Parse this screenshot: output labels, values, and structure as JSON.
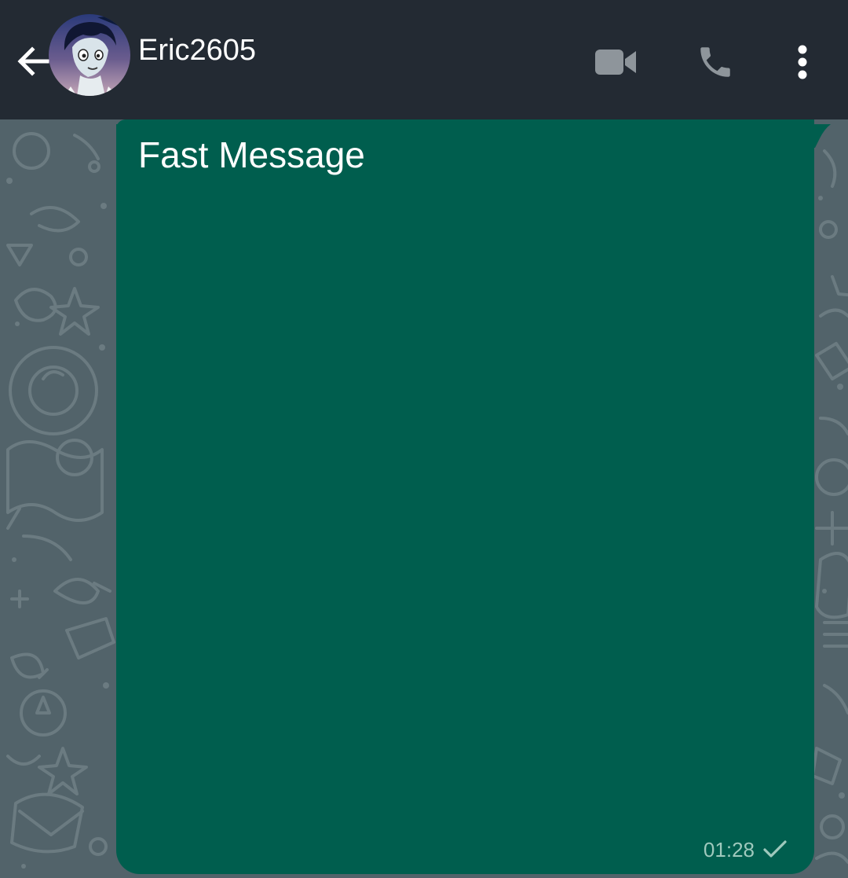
{
  "header": {
    "contact_name": "Eric2605",
    "icons": {
      "back": "back-arrow-icon",
      "video": "video-camera-icon",
      "call": "phone-icon",
      "menu": "more-vertical-icon"
    }
  },
  "conversation": {
    "messages": [
      {
        "direction": "outgoing",
        "text": "Fast Message",
        "time": "01:28",
        "status": "sent",
        "status_icon": "single-check-icon"
      }
    ]
  },
  "colors": {
    "header_bg": "#232a33",
    "wallpaper": "#52636a",
    "outgoing_bubble": "#005e4e",
    "meta_text": "#9fc9bd",
    "header_icon": "#8e959b"
  }
}
